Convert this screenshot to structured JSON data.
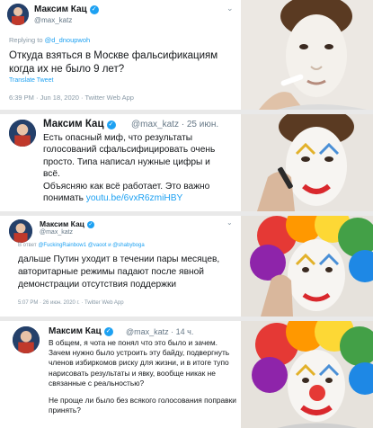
{
  "colors": {
    "accent": "#1da1f2",
    "verified": "#1da1f2",
    "separator": "#e9e9e9"
  },
  "panels": [
    {
      "name": "Максим Кац",
      "handle": "@max_katz",
      "reply_prefix": "Replying to",
      "reply_to": "@d_dnoupwoh",
      "body": "Откуда взяться в Москве фальсификациям когда их не было 9 лет?",
      "translate": "Translate Tweet",
      "meta": "6:39 PM · Jun 18, 2020 · Twitter Web App"
    },
    {
      "name": "Максим Кац",
      "handle": "@max_katz",
      "date": "· 25 июн.",
      "body_lines": [
        "Есть опасный миф, что результаты",
        "голосований сфальсифицировать очень",
        "просто. Типа написал нужные цифры и",
        "всё.",
        "Объясняю как всё работает. Это важно"
      ],
      "body_prefix": "понимать",
      "link": "youtu.be/6vxR6zmiHBY"
    },
    {
      "name": "Максим Кац",
      "handle": "@max_katz",
      "reply_prefix": "В ответ",
      "reply_to": "@FuckingRainbow1 @vaoot и @shabyboga",
      "body": "дальше Путин уходит в течении пары месяцев, авторитарные режимы падают после явной демонстрации отсутствия поддержки",
      "meta": "5:07 PM · 26 июн. 2020 г. · Twitter Web App"
    },
    {
      "name": "Максим Кац",
      "handle": "@max_katz",
      "date": "· 14 ч.",
      "body_p1": "В общем, я чота не понял что это было и зачем. Зачем нужно было устроить эту байду, подвергнуть членов избиркомов риску для жизни, и в итоге тупо нарисовать результаты и явку, вообще никак не связанные с реальностью?",
      "body_p2": "Не проще ли было без всякого голосования поправки принять?"
    }
  ]
}
